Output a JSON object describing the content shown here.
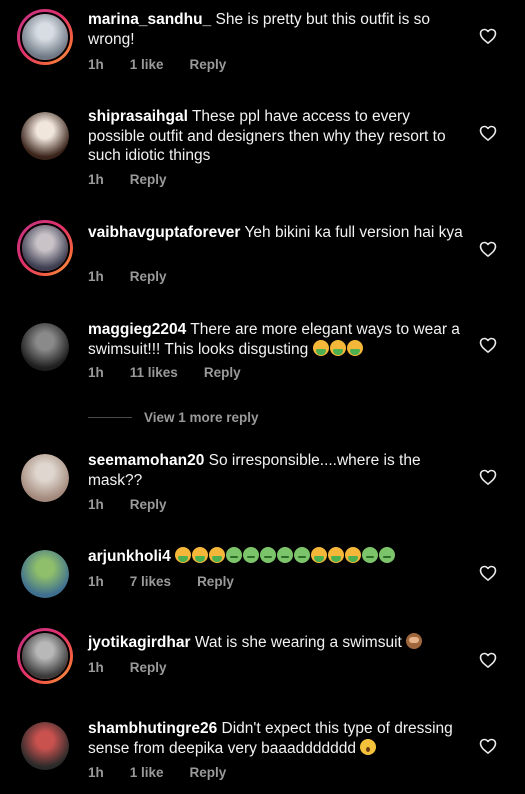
{
  "comments": [
    {
      "username": "marina_sandhu_",
      "text": "She is pretty but this outfit is so wrong!",
      "emojis": [],
      "time": "1h",
      "likes": "1 like",
      "reply": "Reply",
      "story_ring": true,
      "avatar_colors": [
        "#d8dde3",
        "#6f7a86"
      ]
    },
    {
      "username": "shiprasaihgal",
      "text": "These ppl have access to every possible outfit and designers then why they resort to such idiotic things",
      "emojis": [],
      "time": "1h",
      "likes": "",
      "reply": "Reply",
      "story_ring": false,
      "avatar_colors": [
        "#f1e6dc",
        "#3a241a"
      ]
    },
    {
      "username": "vaibhavguptaforever",
      "text": "Yeh bikini ka full version hai kya",
      "emojis": [],
      "time": "1h",
      "likes": "",
      "reply": "Reply",
      "story_ring": true,
      "avatar_colors": [
        "#c9c3c8",
        "#3d3e52"
      ]
    },
    {
      "username": "maggieg2204",
      "text": "There are more elegant ways to wear a swimsuit!!! This looks disgusting",
      "emojis": [
        "vomit",
        "vomit",
        "vomit"
      ],
      "time": "1h",
      "likes": "11 likes",
      "reply": "Reply",
      "story_ring": false,
      "avatar_colors": [
        "#8a8a8a",
        "#1e1e1e"
      ]
    },
    {
      "username": "seemamohan20",
      "text": "So irresponsible....where is the mask??",
      "emojis": [],
      "time": "1h",
      "likes": "",
      "reply": "Reply",
      "story_ring": false,
      "avatar_colors": [
        "#dfd7cf",
        "#a48a7d"
      ]
    },
    {
      "username": "arjunkholi4",
      "text": "",
      "emojis": [
        "vomit",
        "vomit",
        "vomit",
        "nausea",
        "nausea",
        "nausea",
        "nausea",
        "nausea",
        "vomit",
        "vomit",
        "vomit",
        "nausea",
        "nausea"
      ],
      "time": "1h",
      "likes": "7 likes",
      "reply": "Reply",
      "story_ring": false,
      "avatar_colors": [
        "#8fbf6a",
        "#3f6f8f"
      ]
    },
    {
      "username": "jyotikagirdhar",
      "text": "Wat is she wearing a swimsuit",
      "emojis": [
        "monkey"
      ],
      "time": "1h",
      "likes": "",
      "reply": "Reply",
      "story_ring": true,
      "avatar_colors": [
        "#b8b8b8",
        "#3a3a3a"
      ]
    },
    {
      "username": "shambhutingre26",
      "text": "Didn't expect this type of dressing sense from deepika very baaaddddddd",
      "emojis": [
        "wow"
      ],
      "time": "1h",
      "likes": "1 like",
      "reply": "Reply",
      "story_ring": false,
      "avatar_colors": [
        "#c9524f",
        "#2a2a2a"
      ]
    }
  ],
  "view_more_replies": "View 1 more reply",
  "colors": {
    "background": "#000000",
    "username": "#ffffff",
    "body_text": "#f2f2f2",
    "meta_text": "#9a9a9a",
    "story_ring": [
      "#c13584",
      "#e1306c",
      "#f56040",
      "#fcaf45"
    ]
  },
  "icons": {
    "like": "heart-outline-icon"
  }
}
